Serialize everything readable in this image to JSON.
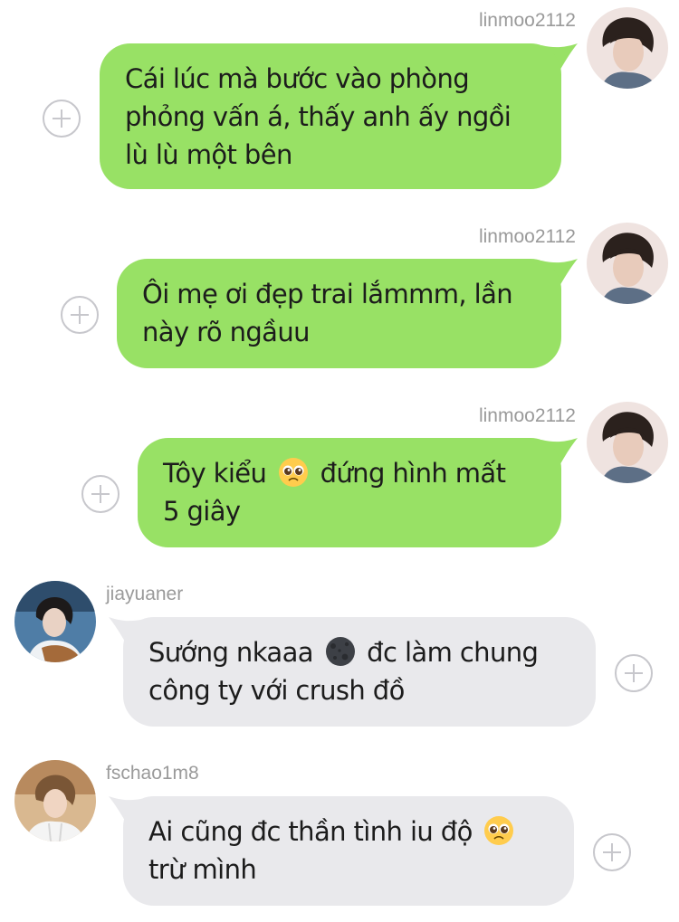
{
  "messages": [
    {
      "direction": "out",
      "username": "linmoo2112",
      "lines": [
        "Cái lúc mà bước vào phòng",
        "phỏng vấn á, thấy anh ấy ngồi",
        "lù lù một bên"
      ]
    },
    {
      "direction": "out",
      "username": "linmoo2112",
      "lines": [
        "Ôi mẹ ơi đẹp trai lắmmm, lần",
        "này rõ ngầuu"
      ]
    },
    {
      "direction": "out",
      "username": "linmoo2112",
      "lines": [
        "Tôy kiểu",
        "đứng hình mất",
        "5 giây"
      ],
      "emoji": "pleading-face-emoji"
    },
    {
      "direction": "in",
      "username": "jiayuaner",
      "lines": [
        "Sướng nkaaa",
        "đc làm chung",
        "công ty với crush đồ"
      ],
      "emoji": "new-moon-face-emoji"
    },
    {
      "direction": "in",
      "username": "fschao1m8",
      "lines": [
        "Ai cũng đc thần tình iu độ",
        "trừ mình"
      ],
      "emoji": "pleading-face-emoji"
    }
  ],
  "icons": {
    "add": "plus-circle-icon",
    "avatar": "profile-photo"
  },
  "colors": {
    "outgoing_bubble": "#98e165",
    "incoming_bubble": "#e9e9ec",
    "username_text": "#9a9a9a",
    "add_icon": "#c7c7cc"
  }
}
